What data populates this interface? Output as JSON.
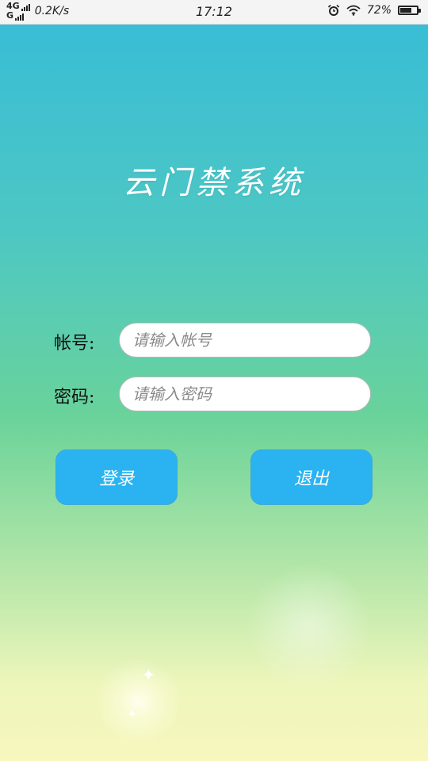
{
  "status_bar": {
    "network_top": "4G",
    "network_bottom": "G",
    "speed": "0.2K/s",
    "time": "17:12",
    "battery_text": "72%",
    "battery_level": 0.72,
    "icons": [
      "signal-icon",
      "alarm-icon",
      "wifi-icon",
      "battery-icon"
    ]
  },
  "app": {
    "title": "云门禁系统"
  },
  "form": {
    "account": {
      "label": "帐号:",
      "placeholder": "请输入帐号",
      "value": ""
    },
    "password": {
      "label": "密码:",
      "placeholder": "请输入密码",
      "value": ""
    }
  },
  "buttons": {
    "login": "登录",
    "exit": "退出"
  },
  "colors": {
    "button": "#2ab3f0",
    "gradient_top": "#36bcd8",
    "gradient_bottom": "#f7f7be",
    "title_text": "#ffffff"
  }
}
